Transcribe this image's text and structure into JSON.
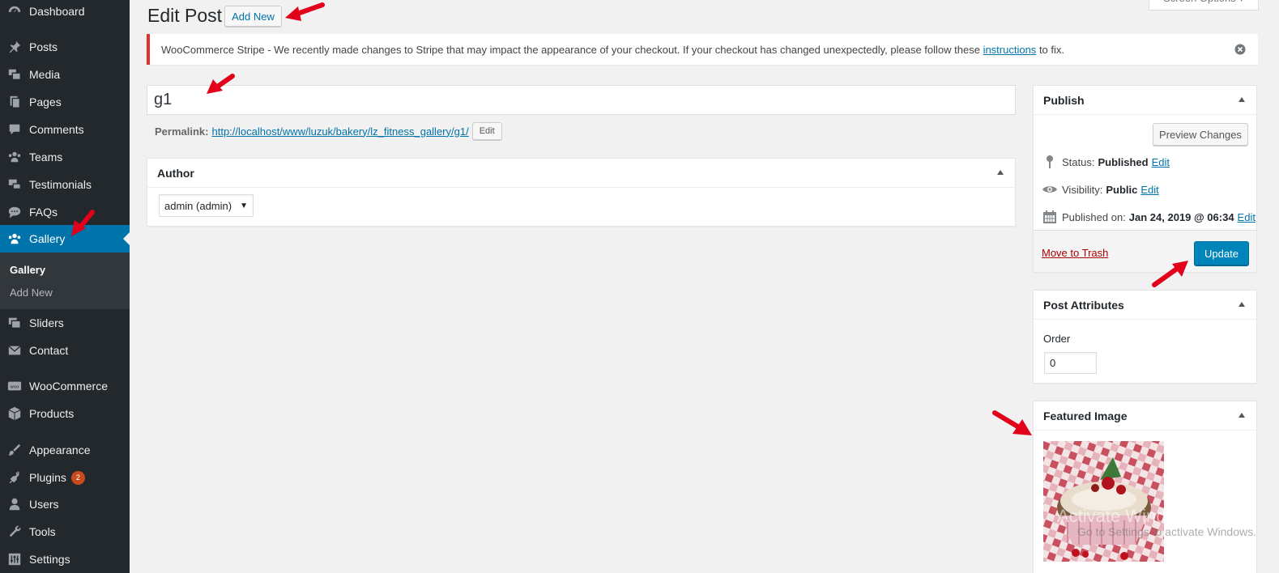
{
  "sidebar": {
    "items": [
      {
        "label": "Dashboard",
        "icon": "dashboard-icon"
      },
      {
        "label": "Posts",
        "icon": "pin-icon"
      },
      {
        "label": "Media",
        "icon": "media-icon"
      },
      {
        "label": "Pages",
        "icon": "pages-icon"
      },
      {
        "label": "Comments",
        "icon": "comments-icon"
      },
      {
        "label": "Teams",
        "icon": "groups-icon"
      },
      {
        "label": "Testimonials",
        "icon": "testimonial-icon"
      },
      {
        "label": "FAQs",
        "icon": "chat-icon"
      },
      {
        "label": "Gallery",
        "icon": "groups-icon"
      },
      {
        "label": "Sliders",
        "icon": "slides-icon"
      },
      {
        "label": "Contact",
        "icon": "email-icon"
      },
      {
        "label": "WooCommerce",
        "icon": "woo-icon"
      },
      {
        "label": "Products",
        "icon": "box-icon"
      },
      {
        "label": "Appearance",
        "icon": "brush-icon"
      },
      {
        "label": "Plugins",
        "icon": "plugin-icon",
        "badge": "2"
      },
      {
        "label": "Users",
        "icon": "user-icon"
      },
      {
        "label": "Tools",
        "icon": "wrench-icon"
      },
      {
        "label": "Settings",
        "icon": "settings-icon"
      }
    ],
    "submenu": {
      "current": "Gallery",
      "add_new": "Add New"
    }
  },
  "header": {
    "title": "Edit Post",
    "add_new": "Add New",
    "screen_options": "Screen Options ▾"
  },
  "notice": {
    "text_before": "WooCommerce Stripe - We recently made changes to Stripe that may impact the appearance of your checkout. If your checkout has changed unexpectedly, please follow these",
    "link": "instructions",
    "text_after": "to fix."
  },
  "post": {
    "title": "g1",
    "permalink_label": "Permalink:",
    "permalink_url": "http://localhost/www/luzuk/bakery/lz_fitness_gallery/g1/",
    "permalink_edit": "Edit"
  },
  "author_box": {
    "title": "Author",
    "selected": "admin (admin)"
  },
  "publish_box": {
    "title": "Publish",
    "preview": "Preview Changes",
    "status_label": "Status:",
    "status_value": "Published",
    "visibility_label": "Visibility:",
    "visibility_value": "Public",
    "published_label": "Published on:",
    "published_value": "Jan 24, 2019 @ 06:34",
    "edit": "Edit",
    "trash": "Move to Trash",
    "update": "Update"
  },
  "attributes_box": {
    "title": "Post Attributes",
    "order_label": "Order",
    "order_value": "0"
  },
  "featured_box": {
    "title": "Featured Image"
  },
  "watermark": {
    "line1": "Activate Windows",
    "line2": "Go to Settings to activate Windows."
  },
  "colors": {
    "sidebar_bg": "#23282d",
    "active": "#0073aa",
    "primary_button": "#0085ba",
    "notice_error": "#dc3232",
    "annotation_arrow": "#e2001a"
  }
}
